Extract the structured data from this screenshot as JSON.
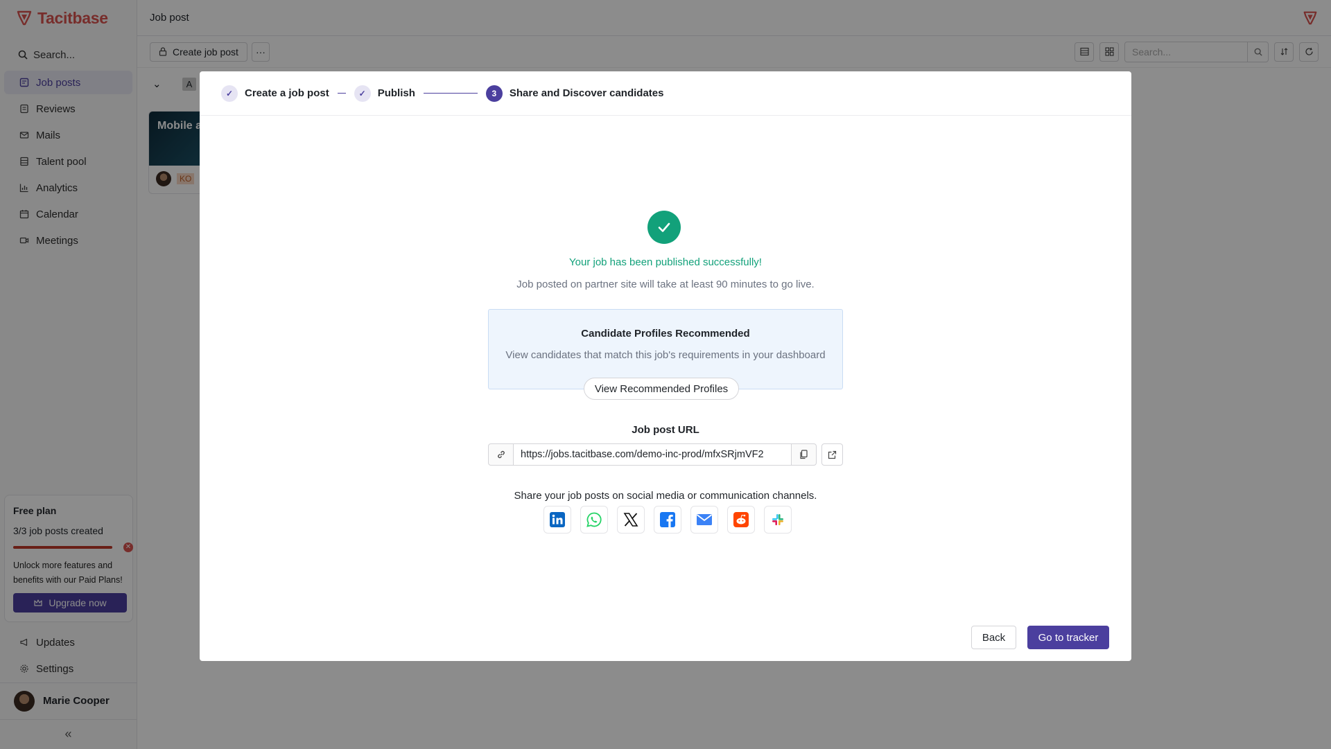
{
  "app": {
    "name": "Tacitbase"
  },
  "colors": {
    "accent": "#4b3f9e",
    "success": "#12a17a",
    "brand": "#d9534f"
  },
  "sidebar": {
    "search_label": "Search...",
    "items": [
      {
        "label": "Job posts",
        "icon": "job-posts-icon"
      },
      {
        "label": "Reviews",
        "icon": "reviews-icon"
      },
      {
        "label": "Mails",
        "icon": "mail-icon"
      },
      {
        "label": "Talent pool",
        "icon": "talent-pool-icon"
      },
      {
        "label": "Analytics",
        "icon": "analytics-icon"
      },
      {
        "label": "Calendar",
        "icon": "calendar-icon"
      },
      {
        "label": "Meetings",
        "icon": "meetings-icon"
      }
    ],
    "plan": {
      "title": "Free plan",
      "usage": "3/3 job posts created",
      "usage_fraction": 1.0,
      "description": "Unlock more features and benefits with our Paid Plans!",
      "upgrade_label": "Upgrade now"
    },
    "bottom_items": [
      {
        "label": "Updates",
        "icon": "megaphone-icon"
      },
      {
        "label": "Settings",
        "icon": "gear-icon"
      }
    ],
    "user": {
      "name": "Marie Cooper"
    }
  },
  "header": {
    "title": "Job post"
  },
  "toolbar": {
    "create_label": "Create job post",
    "search_placeholder": "Search..."
  },
  "background": {
    "filter_chip": "A",
    "card_title": "Mobile a",
    "card_tag": "KO"
  },
  "modal": {
    "steps": [
      {
        "label": "Create a job post",
        "status": "done"
      },
      {
        "label": "Publish",
        "status": "done"
      },
      {
        "number": "3",
        "label": "Share and Discover candidates",
        "status": "current"
      }
    ],
    "success_title": "Your job has been published successfully!",
    "success_subtitle": "Job posted on partner site will take at least 90 minutes to go live.",
    "recommend": {
      "title": "Candidate Profiles Recommended",
      "description": "View candidates that match this job's requirements in your dashboard",
      "button": "View Recommended Profiles"
    },
    "url_label": "Job post URL",
    "url_value": "https://jobs.tacitbase.com/demo-inc-prod/mfxSRjmVF2",
    "share_text": "Share your job posts on social media or communication channels.",
    "share_channels": [
      "linkedin-icon",
      "whatsapp-icon",
      "x-icon",
      "facebook-icon",
      "email-icon",
      "reddit-icon",
      "slack-icon"
    ],
    "back_label": "Back",
    "primary_label": "Go to tracker"
  }
}
